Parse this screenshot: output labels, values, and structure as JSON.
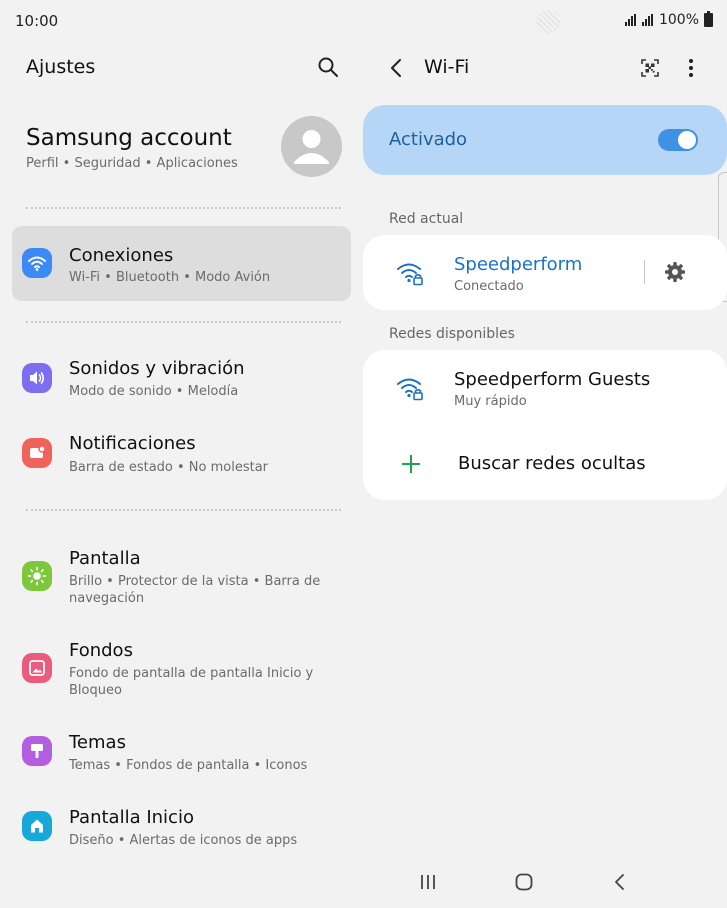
{
  "status_bar": {
    "time": "10:00",
    "battery": "100%"
  },
  "settings_pane": {
    "title": "Ajustes",
    "account": {
      "name": "Samsung account",
      "subtitle": "Perfil  •  Seguridad  •  Aplicaciones"
    },
    "items": [
      {
        "label": "Conexiones",
        "subtitle": "Wi-Fi  •  Bluetooth  •  Modo Avión",
        "icon": "wifi-icon",
        "color": "#3d8af7",
        "selected": true
      },
      {
        "label": "Sonidos y vibración",
        "subtitle": "Modo de sonido  •  Melodía",
        "icon": "speaker-icon",
        "color": "#7d6df0"
      },
      {
        "label": "Notificaciones",
        "subtitle": "Barra de estado  •  No molestar",
        "icon": "notification-icon",
        "color": "#f0635b"
      },
      {
        "label": "Pantalla",
        "subtitle": "Brillo  •  Protector de la vista  •  Barra de navegación",
        "icon": "sun-icon",
        "color": "#7cc83a"
      },
      {
        "label": "Fondos",
        "subtitle": "Fondo de pantalla de pantalla Inicio y Bloqueo",
        "icon": "image-icon",
        "color": "#ec5b7d"
      },
      {
        "label": "Temas",
        "subtitle": "Temas  •  Fondos de pantalla  •  Iconos",
        "icon": "brush-icon",
        "color": "#b35ee0"
      },
      {
        "label": "Pantalla Inicio",
        "subtitle": "Diseño  •  Alertas de iconos de apps",
        "icon": "home-icon",
        "color": "#16a8d8"
      }
    ]
  },
  "wifi_pane": {
    "title": "Wi-Fi",
    "toggle_label": "Activado",
    "toggle_on": true,
    "current_network_label": "Red actual",
    "current_network": {
      "name": "Speedperform",
      "status": "Conectado"
    },
    "available_networks_label": "Redes disponibles",
    "available_networks": [
      {
        "name": "Speedperform Guests",
        "status": "Muy rápido"
      }
    ],
    "search_hidden_label": "Buscar redes ocultas"
  },
  "colors": {
    "accent": "#1a72c4",
    "toggle": "#3e91e5",
    "plus": "#1ea355"
  }
}
